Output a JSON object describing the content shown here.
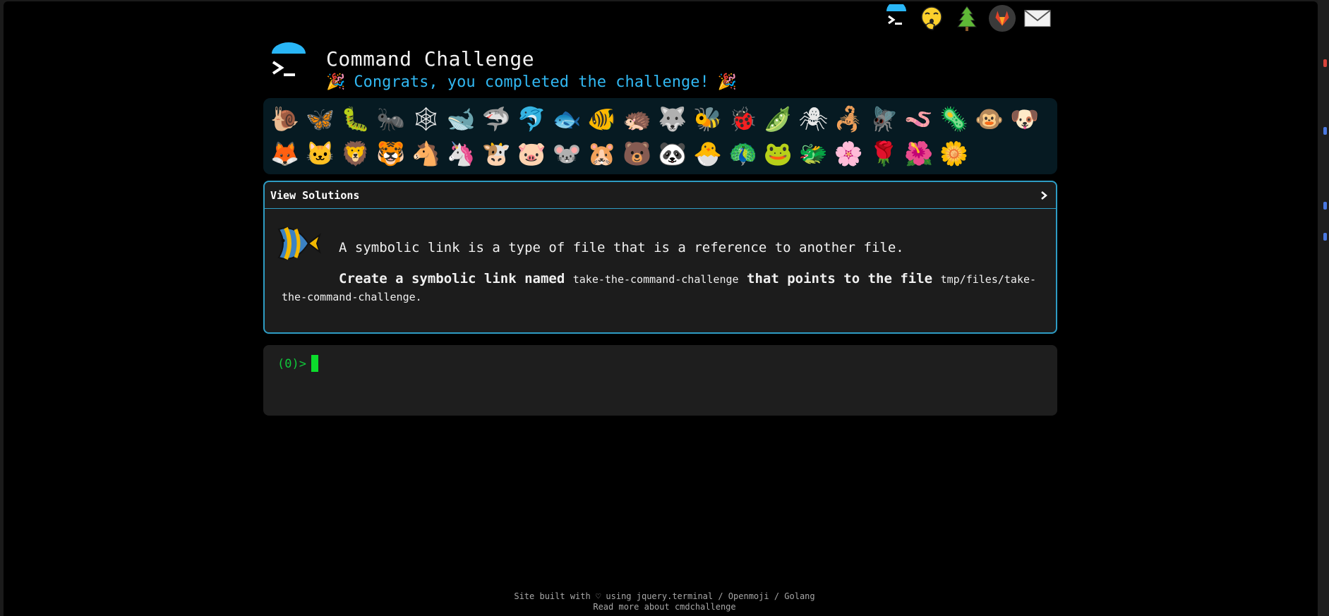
{
  "header": {
    "title": "Command Challenge",
    "congrats": "Congrats, you completed the challenge!",
    "party_glyph": "🎉"
  },
  "top_icons": [
    "terminal-icon",
    "hand-over-mouth-icon",
    "tree-icon",
    "gitlab-icon",
    "mail-icon"
  ],
  "emojis": [
    "🐌",
    "🦋",
    "🐛",
    "🐜",
    "🕸",
    "🐋",
    "🦈",
    "🐬",
    "🐟",
    "🐠",
    "🦔",
    "🐺",
    "🐝",
    "🐞",
    "🫛",
    "🕷",
    "🦂",
    "🪰",
    "🪱",
    "🦠",
    "🐵",
    "🐶",
    "🦊",
    "🐱",
    "🦁",
    "🐯",
    "🐴",
    "🦄",
    "🐮",
    "🐷",
    "🐭",
    "🐹",
    "🐻",
    "🐼",
    "🐣",
    "🦚",
    "🐸",
    "🐲",
    "🌸",
    "🌹",
    "🌺",
    "🌼"
  ],
  "solutions": {
    "label": "View Solutions",
    "description": "A symbolic link is a type of file that is a reference to another file.",
    "task_prefix": "Create a symbolic link named",
    "link_name": "take-the-command-challenge",
    "task_middle": "that points to the file",
    "target_path": "tmp/files/take-the-command-challenge",
    "task_suffix": "."
  },
  "terminal": {
    "prompt": "(0)>"
  },
  "footer": {
    "line1": "Site built with ♡ using jquery.terminal / Openmoji / Golang",
    "line2": "Read more about cmdchallenge"
  },
  "colors": {
    "accent": "#31b8f2",
    "border": "#2e9cc4",
    "prompt": "#10c93a",
    "panel": "#061a22"
  }
}
